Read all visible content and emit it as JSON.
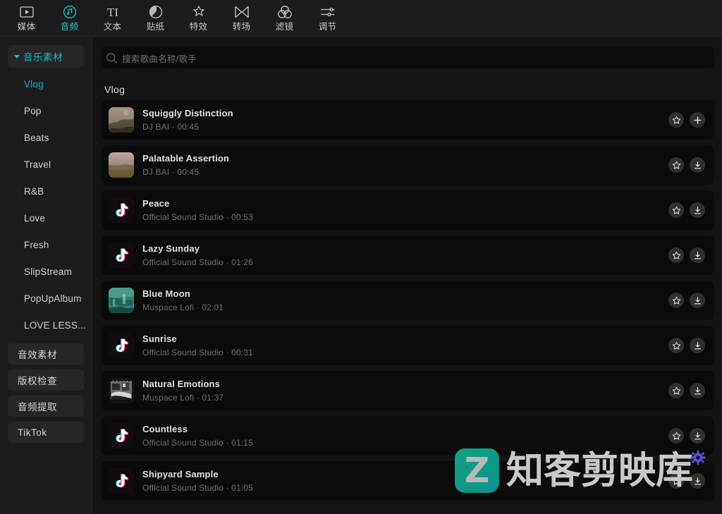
{
  "toolbar": {
    "tabs": [
      {
        "label": "媒体",
        "icon": "media-play-frame-icon",
        "active": false
      },
      {
        "label": "音频",
        "icon": "audio-note-icon",
        "active": true
      },
      {
        "label": "文本",
        "icon": "text-ti-icon",
        "active": false
      },
      {
        "label": "贴纸",
        "icon": "sticker-circle-icon",
        "active": false
      },
      {
        "label": "特效",
        "icon": "effects-sparkle-icon",
        "active": false
      },
      {
        "label": "转场",
        "icon": "transition-bowtie-icon",
        "active": false
      },
      {
        "label": "滤镜",
        "icon": "filter-circles-icon",
        "active": false
      },
      {
        "label": "调节",
        "icon": "adjust-sliders-icon",
        "active": false
      }
    ]
  },
  "sidebar": {
    "group": {
      "label": "音乐素材",
      "expanded": true,
      "caret": "chevron-down-icon"
    },
    "items": [
      {
        "label": "Vlog",
        "active": true
      },
      {
        "label": "Pop",
        "active": false
      },
      {
        "label": "Beats",
        "active": false
      },
      {
        "label": "Travel",
        "active": false
      },
      {
        "label": "R&B",
        "active": false
      },
      {
        "label": "Love",
        "active": false
      },
      {
        "label": "Fresh",
        "active": false
      },
      {
        "label": "SlipStream",
        "active": false
      },
      {
        "label": "PopUpAlbum",
        "active": false
      },
      {
        "label": "LOVE LESS...",
        "active": false
      }
    ],
    "buttons": [
      {
        "label": "音效素材"
      },
      {
        "label": "版权检查"
      },
      {
        "label": "音频提取"
      },
      {
        "label": "TikTok"
      }
    ]
  },
  "search": {
    "placeholder": "搜索歌曲名称/歌手",
    "value": "",
    "icon": "search-icon"
  },
  "main": {
    "section_title": "Vlog",
    "tracks": [
      {
        "title": "Squiggly Distinction",
        "artist": "DJ BAI",
        "separator": "·",
        "duration": "00:45",
        "thumb": "landscape-painting-thumb",
        "favorite_icon": "star-icon",
        "action_icon": "plus-icon"
      },
      {
        "title": "Palatable Assertion",
        "artist": "DJ BAI",
        "separator": "·",
        "duration": "00:45",
        "thumb": "desert-painting-thumb",
        "favorite_icon": "star-icon",
        "action_icon": "download-icon"
      },
      {
        "title": "Peace",
        "artist": "Official Sound Studio",
        "separator": "·",
        "duration": "00:53",
        "thumb": "tiktok-note-thumb",
        "favorite_icon": "star-icon",
        "action_icon": "download-icon"
      },
      {
        "title": "Lazy Sunday",
        "artist": "Official Sound Studio",
        "separator": "·",
        "duration": "01:26",
        "thumb": "tiktok-note-thumb",
        "favorite_icon": "star-icon",
        "action_icon": "download-icon"
      },
      {
        "title": "Blue Moon",
        "artist": "Muspace Lofi",
        "separator": "·",
        "duration": "02:01",
        "thumb": "green-collage-thumb",
        "favorite_icon": "star-icon",
        "action_icon": "download-icon"
      },
      {
        "title": "Sunrise",
        "artist": "Official Sound Studio",
        "separator": "·",
        "duration": "00:31",
        "thumb": "tiktok-note-thumb",
        "favorite_icon": "star-icon",
        "action_icon": "download-icon"
      },
      {
        "title": "Natural Emotions",
        "artist": "Muspace Lofi",
        "separator": "·",
        "duration": "01:37",
        "thumb": "bw-photo-thumb",
        "favorite_icon": "star-icon",
        "action_icon": "download-icon"
      },
      {
        "title": "Countless",
        "artist": "Official Sound Studio",
        "separator": "·",
        "duration": "01:15",
        "thumb": "tiktok-note-thumb",
        "favorite_icon": "star-icon",
        "action_icon": "download-icon"
      },
      {
        "title": "Shipyard Sample",
        "artist": "Official Sound Studio",
        "separator": "·",
        "duration": "01:05",
        "thumb": "tiktok-note-thumb",
        "favorite_icon": "star-icon",
        "action_icon": "download-icon"
      }
    ]
  },
  "watermark": {
    "logo_letter": "Z",
    "text": "知客剪映库",
    "gear_icon": "gear-icon",
    "gear_color": "#5b4fd6",
    "logo_color": "#11a083"
  },
  "colors": {
    "accent": "#16b6c6",
    "toolbar_bg": "#1c1c1c",
    "panel_bg": "#141414",
    "card_bg": "#0b0b0b"
  }
}
